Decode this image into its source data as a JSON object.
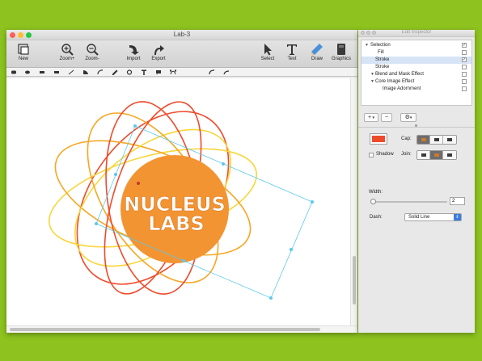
{
  "window": {
    "title": "Lab-3",
    "traffic_lights": [
      "#ff5f57",
      "#ffbd2e",
      "#28c940"
    ]
  },
  "toolbar": {
    "new_label": "New",
    "zoom_in_label": "Zoom+",
    "zoom_out_label": "Zoom-",
    "import_label": "Import",
    "export_label": "Export",
    "select_label": "Select",
    "text_label": "Text",
    "draw_label": "Draw",
    "graphics_label": "Graphics"
  },
  "shape_tools": [
    "rounded-rect-icon",
    "oval-icon",
    "rect-icon",
    "rect-icon",
    "line-icon",
    "pie-icon",
    "arc-icon",
    "pen-icon",
    "ring-icon",
    "text-tool-icon",
    "speech-bubble-icon",
    "bezier-icon",
    "curve-icon",
    "curve-icon"
  ],
  "artwork": {
    "logo_line1": "NUCLEUS",
    "logo_line2": "LABS",
    "circle_color": "#f39432",
    "orbit_colors": [
      "#ef4a2a",
      "#f6a623",
      "#f7d63b"
    ],
    "selection_color": "#5bc8ec"
  },
  "inspector": {
    "title": "Edit Inspector",
    "tree": [
      {
        "label": "Selection",
        "checked": true,
        "expanded": true
      },
      {
        "label": "Fill",
        "checked": false
      },
      {
        "label": "Stroke",
        "checked": true,
        "selected": true
      },
      {
        "label": "Stroke",
        "checked": false
      },
      {
        "label": "Blend and Mask Effect",
        "checked": false,
        "expanded": true
      },
      {
        "label": "Core Image Effect",
        "checked": false,
        "expanded": true
      },
      {
        "label": "Image Adornment",
        "checked": false
      }
    ],
    "add_button": "+",
    "remove_button": "−",
    "stroke_color": "#ef4a2a",
    "cap_label": "Cap:",
    "shadow_label": "Shadow",
    "join_label": "Join:",
    "width_label": "Width:",
    "width_value": "2",
    "width_fraction": 0.02,
    "dash_label": "Dash:",
    "dash_value": "Solid Line"
  }
}
